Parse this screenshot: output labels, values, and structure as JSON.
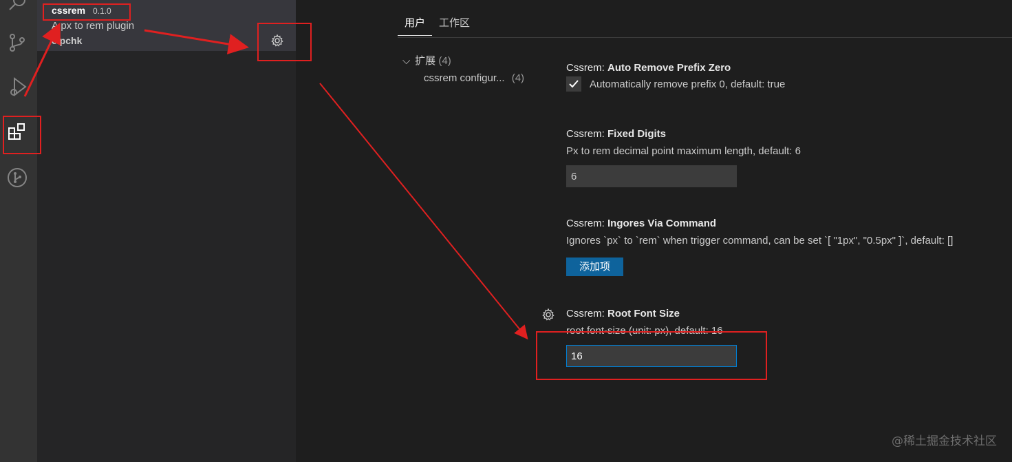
{
  "extension": {
    "name": "cssrem",
    "version": "0.1.0",
    "description": "A px to rem plugin",
    "publisher": "cipchk"
  },
  "settings": {
    "tabs": [
      {
        "label": "用户",
        "active": true
      },
      {
        "label": "工作区",
        "active": false
      }
    ],
    "toc": {
      "group_label": "扩展",
      "group_count": "(4)",
      "item_label": "cssrem configur...",
      "item_count": "(4)"
    },
    "items": [
      {
        "category": "Cssrem: ",
        "key": "Auto Remove Prefix Zero",
        "checkbox_label": "Automatically remove prefix 0, default: true",
        "checked": true
      },
      {
        "category": "Cssrem: ",
        "key": "Fixed Digits",
        "description": "Px to rem decimal point maximum length, default: 6",
        "value": "6"
      },
      {
        "category": "Cssrem: ",
        "key": "Ingores Via Command",
        "description": "Ignores `px` to `rem` when trigger command, can be set `[ \"1px\", \"0.5px\" ]`, default: []",
        "button_label": "添加项"
      },
      {
        "category": "Cssrem: ",
        "key": "Root Font Size",
        "description": "root font-size (unit: px), default: 16",
        "value": "16"
      }
    ]
  },
  "watermark": "@稀土掘金技术社区",
  "colors": {
    "accent": "#0e639c",
    "focus_border": "#007fd4",
    "annotation": "#e02020"
  }
}
